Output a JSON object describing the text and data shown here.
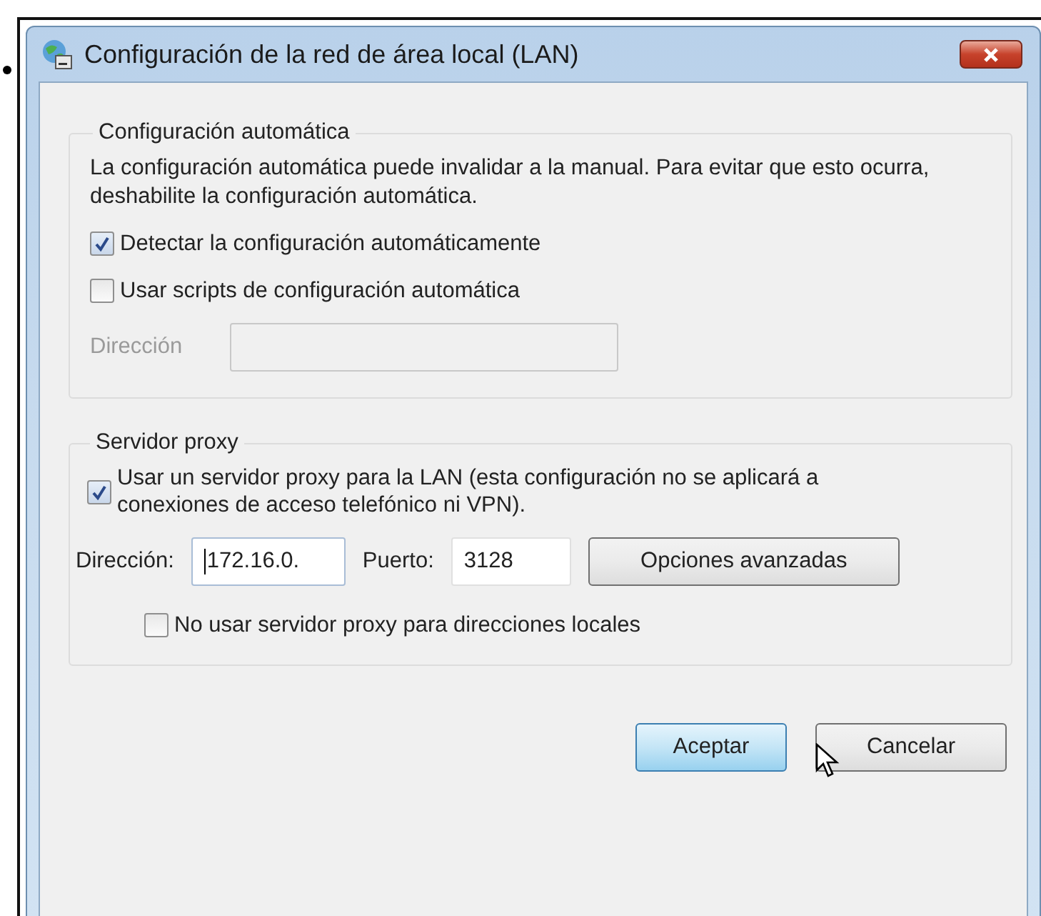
{
  "window": {
    "title": "Configuración de la red de área local (LAN)"
  },
  "auto_config": {
    "title": "Configuración automática",
    "description": "La configuración automática puede invalidar a la manual. Para evitar que esto ocurra, deshabilite la configuración automática.",
    "options": [
      {
        "label": "Detectar la configuración automáticamente",
        "checked": true
      },
      {
        "label": "Usar scripts de configuración automática",
        "checked": false
      }
    ],
    "address": {
      "label": "Dirección",
      "disabled": true
    }
  },
  "proxy": {
    "title": "Servidor proxy",
    "use_proxy": {
      "label": "Usar un servidor proxy para la LAN (esta configuración no se aplicará a conexiones de acceso telefónico ni VPN).",
      "checked": true
    },
    "address": {
      "label": "Dirección:",
      "value": "172.16.0."
    },
    "port": {
      "label": "Puerto:",
      "value": "3128"
    },
    "advanced_button": "Opciones avanzadas",
    "bypass_local": {
      "label": "No usar servidor proxy para direcciones locales",
      "checked": false
    }
  },
  "buttons": [
    {
      "label": "Aceptar",
      "kind": "default"
    },
    {
      "label": "Cancelar",
      "kind": "normal"
    }
  ]
}
